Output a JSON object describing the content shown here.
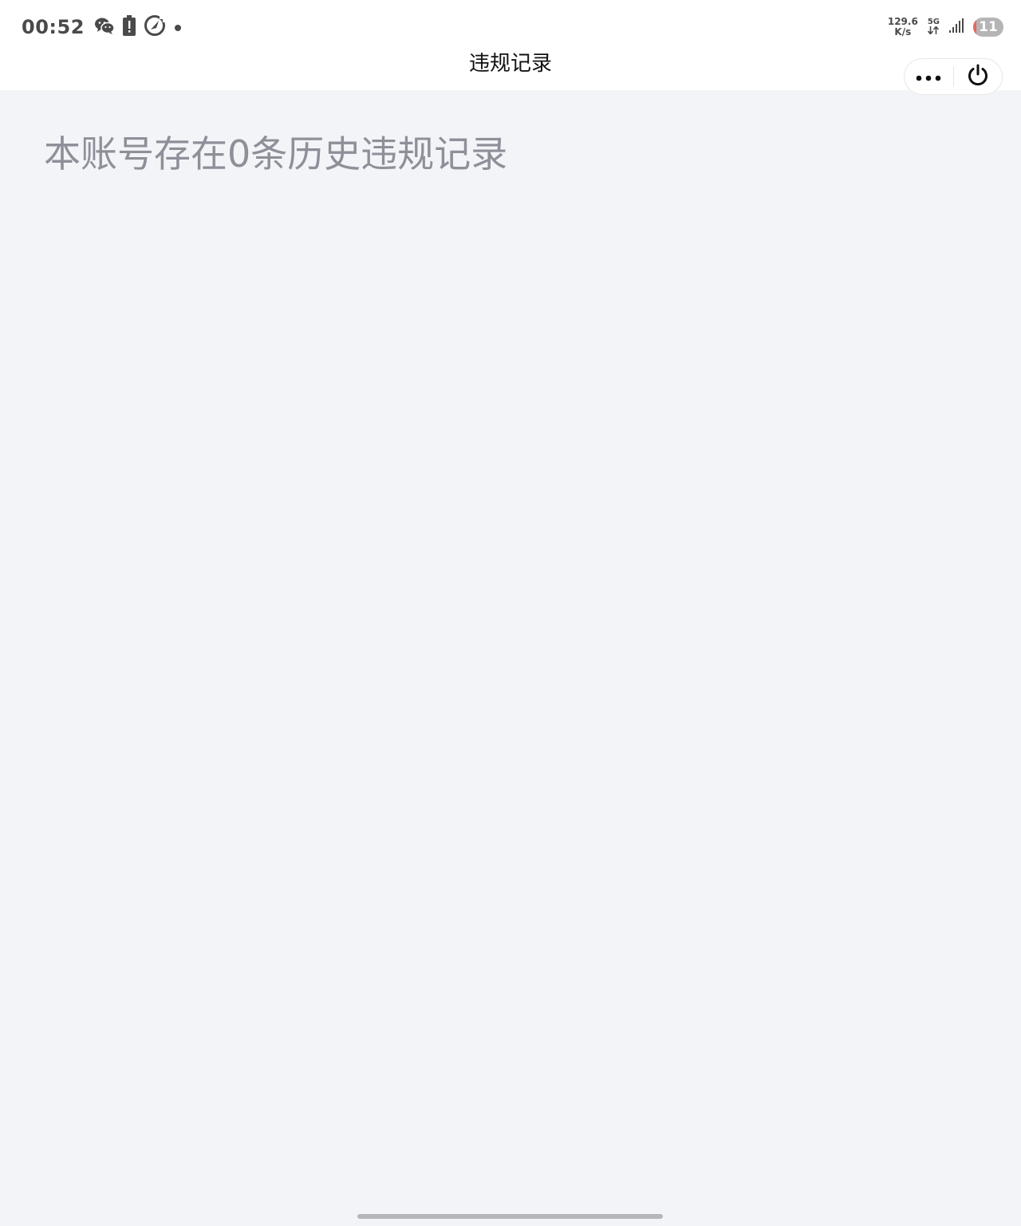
{
  "status_bar": {
    "time": "00:52",
    "net_speed_value": "129.6",
    "net_speed_unit": "K/s",
    "network_type": "5G",
    "battery_level": "11",
    "battery_fraction": 0.11,
    "icons": [
      "wechat-icon",
      "battery-alert-icon",
      "speed-boost-icon",
      "notification-dot-icon",
      "data-transfer-icon",
      "signal-icon",
      "battery-icon"
    ]
  },
  "nav": {
    "title": "违规记录",
    "more_icon": "more-dots-icon",
    "close_icon": "power-icon"
  },
  "content": {
    "summary": "本账号存在0条历史违规记录"
  },
  "colors": {
    "page_background": "#f3f4f8",
    "bar_background": "#ffffff",
    "summary_text": "#8f8f99",
    "battery_low": "#e66a5a"
  }
}
